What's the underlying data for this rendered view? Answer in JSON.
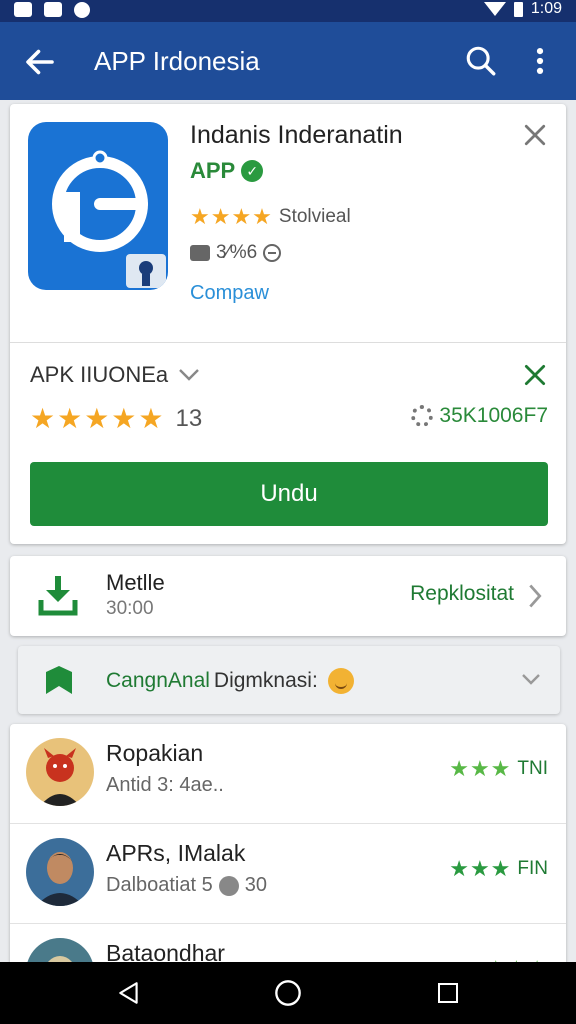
{
  "status": {
    "time": "1:09"
  },
  "appbar": {
    "title": "APP Irdonesia",
    "back_icon": "arrow-left-icon",
    "search_icon": "search-icon",
    "more_icon": "more-vert-icon"
  },
  "app": {
    "name": "Indanis Inderanatin",
    "developer": "APP",
    "stars": "★★★★",
    "rating_label": "Stolvieal",
    "size": "3⁄%6",
    "compare_link": "Compaw"
  },
  "rating_section": {
    "title": "APK IIUONEa",
    "stars": "★★★★★",
    "count": "13",
    "downloads": "35K1006F7",
    "install_label": "Undu"
  },
  "download": {
    "title": "Metlle",
    "time": "30:00",
    "action": "Repklositat"
  },
  "category": {
    "label_a": "CangnAnal",
    "label_b": "Digmknasi:"
  },
  "reviews": [
    {
      "name": "Ropakian",
      "sub": "Antid 3: 4ae..",
      "stars": "★★★",
      "label": "TNI"
    },
    {
      "name": "APRs, IMalak",
      "sub": "Dalboatiat 5",
      "sub_num": "30",
      "stars": "★★★",
      "label": "FIN"
    },
    {
      "name": "Bataondhar",
      "sub": "",
      "stars": "★★★",
      "label": ""
    }
  ],
  "colors": {
    "appbar": "#1f4d99",
    "statusbar": "#16306e",
    "accent_green": "#1f8c3a",
    "star_yellow": "#f5a623",
    "star_green": "#58b846"
  }
}
